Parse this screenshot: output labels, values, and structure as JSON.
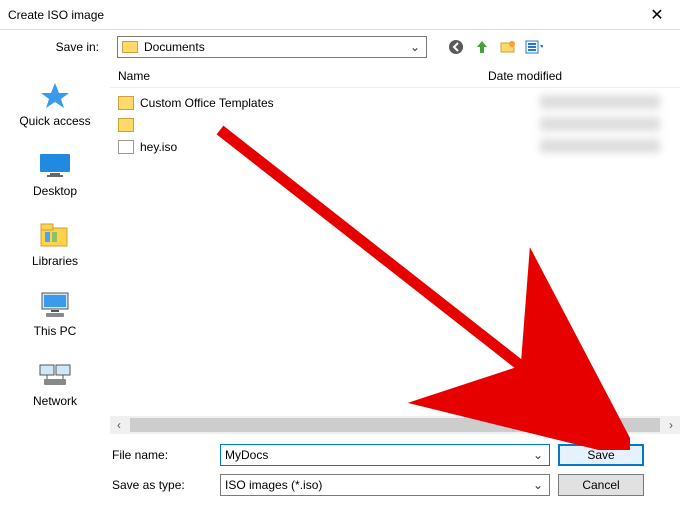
{
  "window": {
    "title": "Create ISO image"
  },
  "topbar": {
    "save_in_label": "Save in:",
    "location": "Documents"
  },
  "columns": {
    "name": "Name",
    "date": "Date modified"
  },
  "sidebar": {
    "quick_access": "Quick access",
    "desktop": "Desktop",
    "libraries": "Libraries",
    "this_pc": "This PC",
    "network": "Network"
  },
  "files": [
    {
      "name": "Custom Office Templates",
      "type": "folder"
    },
    {
      "name": "",
      "type": "folder"
    },
    {
      "name": "hey.iso",
      "type": "file"
    }
  ],
  "form": {
    "file_name_label": "File name:",
    "file_name_value": "MyDocs",
    "save_as_type_label": "Save as type:",
    "save_as_type_value": "ISO images (*.iso)"
  },
  "buttons": {
    "save": "Save",
    "cancel": "Cancel"
  }
}
